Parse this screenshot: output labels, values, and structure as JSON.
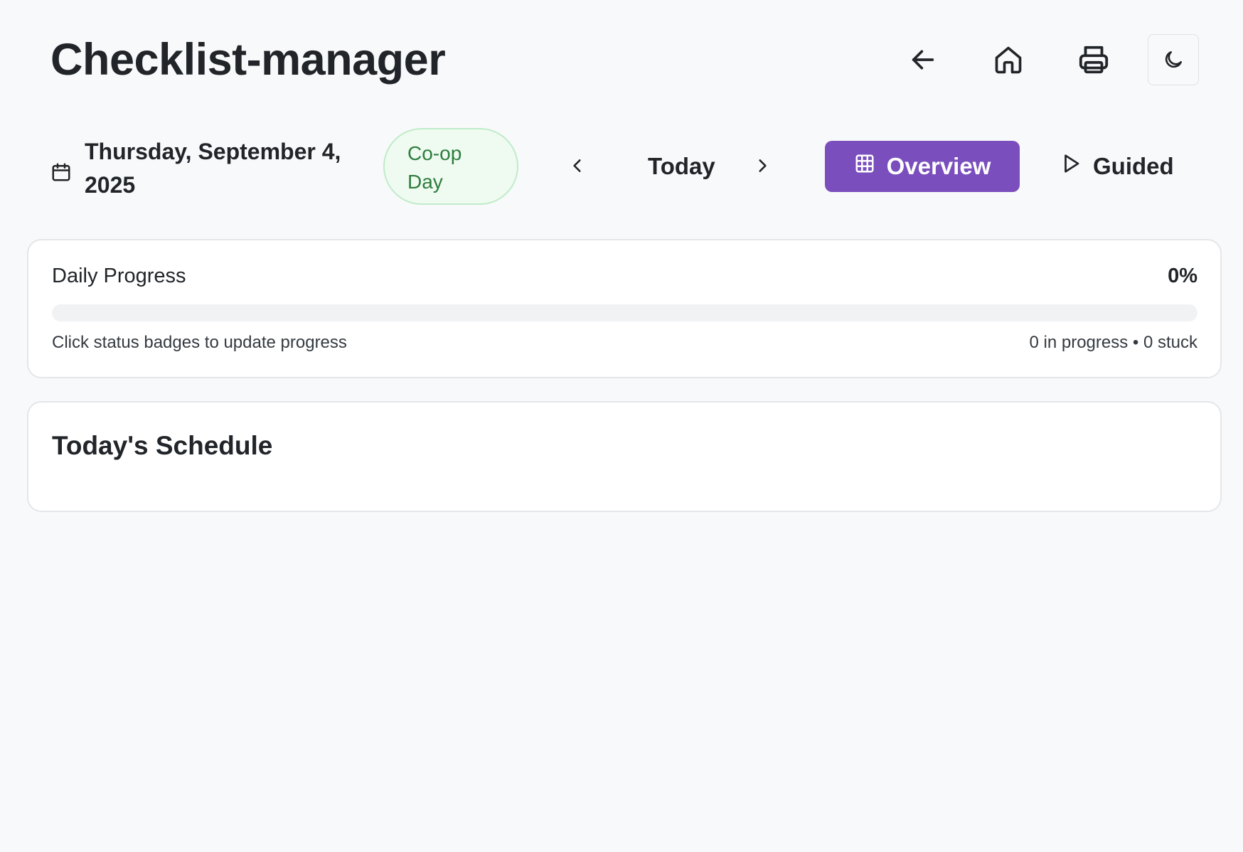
{
  "app": {
    "title": "Checklist-manager"
  },
  "header": {
    "actions": [
      {
        "name": "back",
        "icon": "arrow-left-icon"
      },
      {
        "name": "home",
        "icon": "home-icon"
      },
      {
        "name": "print",
        "icon": "printer-icon"
      },
      {
        "name": "theme",
        "icon": "moon-icon"
      }
    ]
  },
  "toolbar": {
    "calendar_icon": "calendar-icon",
    "date": "Thursday, September 4, 2025",
    "day_badge": "Co-op Day",
    "today_label": "Today",
    "prev_icon": "chevron-left-icon",
    "next_icon": "chevron-right-icon",
    "overview_label": "Overview",
    "overview_icon": "grid-icon",
    "guided_label": "Guided",
    "guided_icon": "play-icon"
  },
  "progress": {
    "label": "Daily Progress",
    "percent_text": "0%",
    "percent_value": 0,
    "hint": "Click status badges to update progress",
    "stats": "0 in progress • 0 stuck"
  },
  "schedule": {
    "title": "Today's Schedule"
  },
  "colors": {
    "accent": "#7a4ebd",
    "badge_bg": "#effbf1",
    "badge_border": "#bfecc8",
    "badge_text": "#2e7d3e",
    "page_bg": "#f8f9fa"
  }
}
